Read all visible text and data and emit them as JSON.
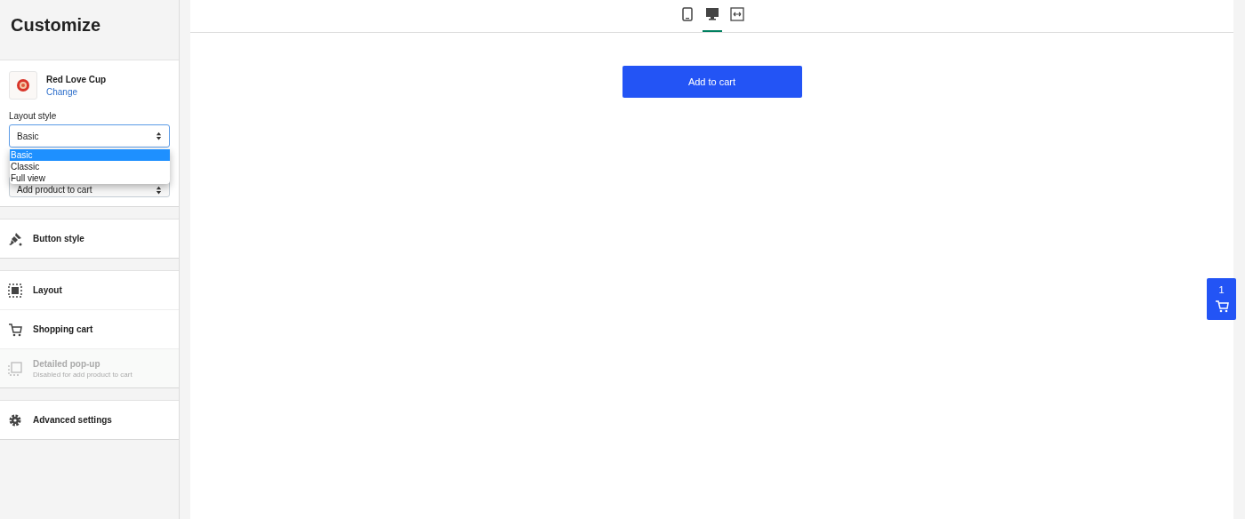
{
  "title": "Customize",
  "product": {
    "name": "Red Love Cup",
    "change_link": "Change"
  },
  "layout_style": {
    "label": "Layout style",
    "value": "Basic",
    "expanded": true,
    "options": [
      {
        "label": "Basic",
        "selected": true
      },
      {
        "label": "Classic",
        "selected": false
      },
      {
        "label": "Full view",
        "selected": false
      }
    ]
  },
  "action_select": {
    "value": "Add product to cart"
  },
  "groups": [
    {
      "items": [
        {
          "kind": "brush",
          "label": "Button style",
          "disabled": false
        }
      ]
    },
    {
      "items": [
        {
          "kind": "layout",
          "label": "Layout",
          "disabled": false
        },
        {
          "kind": "cart",
          "label": "Shopping cart",
          "disabled": false
        },
        {
          "kind": "popup",
          "label": "Detailed pop-up",
          "note": "Disabled for add product to cart",
          "disabled": true
        }
      ]
    },
    {
      "items": [
        {
          "kind": "gear",
          "label": "Advanced settings",
          "disabled": false
        }
      ]
    }
  ],
  "device_tabs": [
    {
      "kind": "mobile",
      "selected": false
    },
    {
      "kind": "desktop",
      "selected": true
    },
    {
      "kind": "fullwidth",
      "selected": false
    }
  ],
  "preview": {
    "button": "Add to cart"
  },
  "cart_badge": {
    "count": "1"
  }
}
